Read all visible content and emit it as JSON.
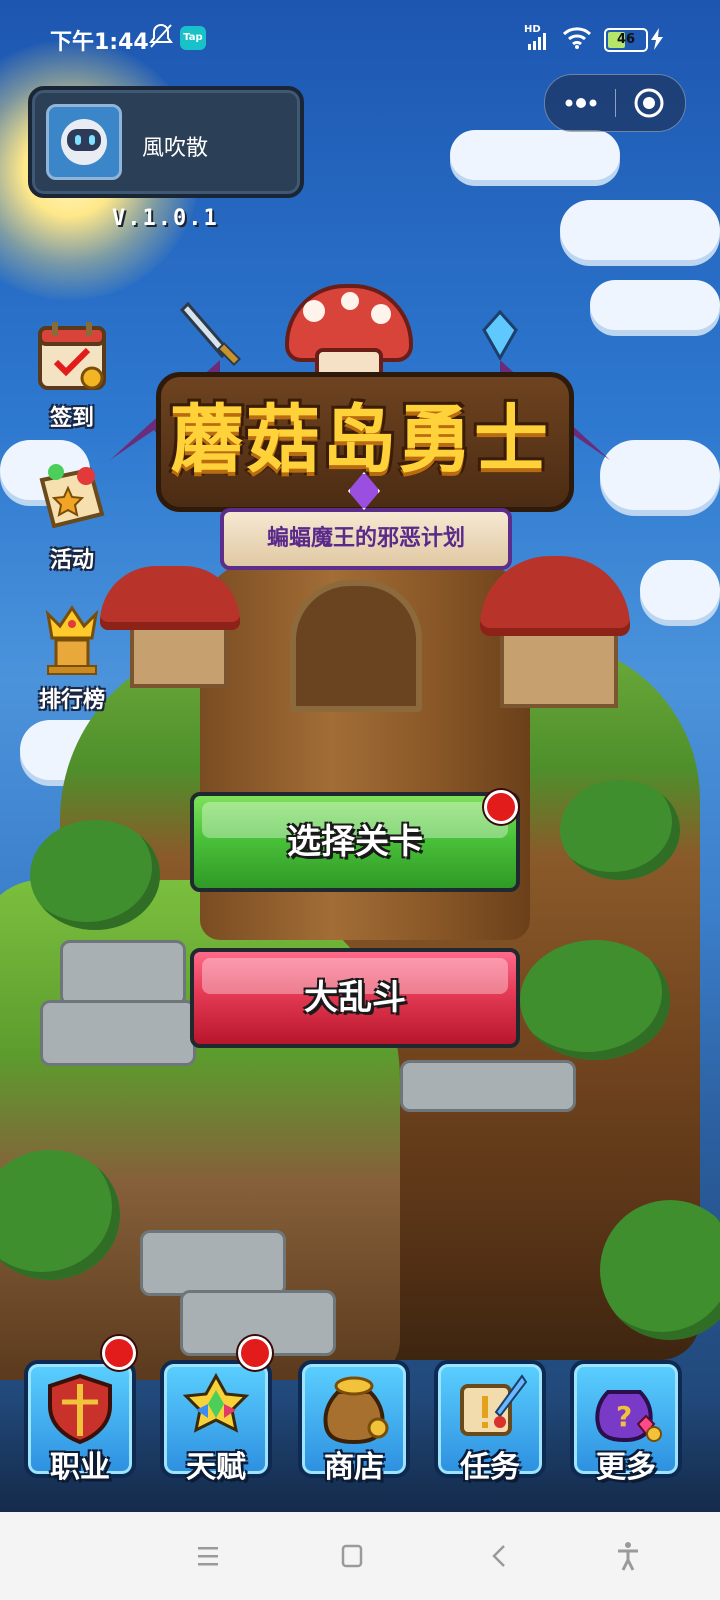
{
  "status_bar": {
    "time": "下午1:44",
    "tap_badge": "Tap",
    "network": "HD",
    "battery": "46",
    "battery_level": 0.46
  },
  "profile": {
    "name": "風吹散"
  },
  "version": "V.1.0.1",
  "logo": {
    "title": "蘑菇岛勇士",
    "subtitle": "蝙蝠魔王的邪恶计划"
  },
  "side_menu": [
    {
      "label": "签到",
      "icon": "calendar-checkin-icon"
    },
    {
      "label": "活动",
      "icon": "event-ticket-icon"
    },
    {
      "label": "排行榜",
      "icon": "crown-trophy-icon"
    }
  ],
  "main_buttons": {
    "select_level": "选择关卡",
    "brawl": "大乱斗"
  },
  "bottom_nav": [
    {
      "label": "职业",
      "icon": "shield-sword-icon",
      "badge": true
    },
    {
      "label": "天赋",
      "icon": "rainbow-gem-icon",
      "badge": true
    },
    {
      "label": "商店",
      "icon": "gold-bag-icon",
      "badge": false
    },
    {
      "label": "任务",
      "icon": "scroll-quill-icon",
      "badge": false
    },
    {
      "label": "更多",
      "icon": "mystery-bag-icon",
      "badge": false
    }
  ],
  "colors": {
    "green_button": "#4bc23a",
    "red_button": "#e43a55",
    "badge_red": "#e21b1b",
    "title_gold": "#ffd23a"
  }
}
